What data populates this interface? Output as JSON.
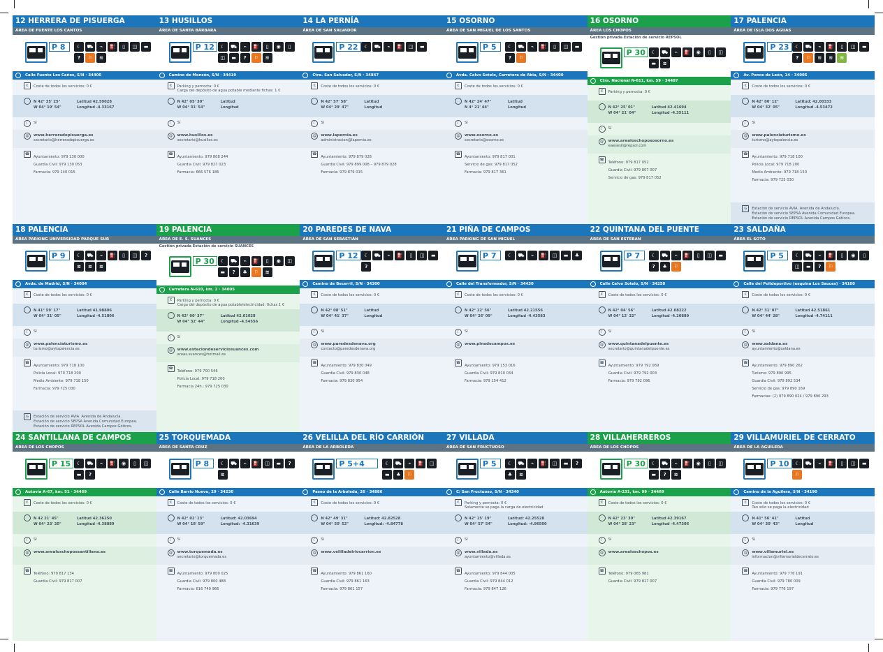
{
  "cards": [
    {
      "title": "12 HERRERA DE PISUERGA",
      "area": "ÁREA DE FUENTE LOS CANTOS",
      "note": "",
      "p": "P   8",
      "svc": [
        "☾",
        "⛟",
        "⌁",
        "⛽",
        "▯",
        "◫",
        "▬",
        "?",
        "⚐",
        "≋"
      ],
      "addr": "Calle Fuente Los Caños, S/N · 34400",
      "cost": [
        "Coste de todos los servicios: 0 €"
      ],
      "n": "N 42° 35' 25\"",
      "w": "W 04° 19' 54\"",
      "lat": "Latitud 42.59028",
      "lon": "Longitud -4.33167",
      "open": "Sí",
      "web": "www.herreradepisuerga.es",
      "mail": "secretario@herreradepisuerga.es",
      "tel": [
        "Ayuntamiento: 979 130 000",
        "Guardia Civil: 979 130 053",
        "Farmacia: 979 140 015"
      ],
      "glp": []
    },
    {
      "title": "13 HUSILLOS",
      "area": "ÁREA DE SANTA BÁRBARA",
      "note": "",
      "p": "P 12",
      "svc": [
        "☾",
        "⛟",
        "⌁",
        "⛽",
        "▯",
        "◉",
        "▯",
        "◫",
        "▬",
        "?",
        "⚐",
        "≋"
      ],
      "addr": "Camino de Monzón, S/N · 34419",
      "cost": [
        "Parking y pernocta: 0 €",
        "Carga del depósito de agua potable mediante fichas: 1 €"
      ],
      "n": "N 42° 05' 30\"",
      "w": "W 04° 31' 54\"",
      "lat": "Latitud",
      "lon": "Longitud",
      "open": "Sí",
      "web": "www.husillos.es",
      "mail": "secretario@husillos.es",
      "tel": [
        "Ayuntamiento: 979 808 244",
        "Guardia Civil: 979 827 023",
        "Farmacia: 666 576 186"
      ],
      "glp": []
    },
    {
      "title": "14 LA PERNÍA",
      "area": "ÁREA DE SAN SALVADOR",
      "note": "",
      "p": "P 22",
      "svc": [
        "☾",
        "⛟",
        "⌁",
        "⛽",
        "◫",
        "▬"
      ],
      "addr": "Ctra. San Salvador, S/N · 34847",
      "cost": [
        "Coste de todos los servicios: 0 €"
      ],
      "n": "N 42° 57' 58\"",
      "w": "W 04° 29' 47\"",
      "lat": "Latitud",
      "lon": "Longitud",
      "open": "Sí",
      "web": "www.lapernia.es",
      "mail": "administracion@lapernia.es",
      "tel": [
        "Ayuntamiento: 979 879 028",
        "Guardia Civil: 979 899 008 – 979 879 028",
        "Farmacia: 979 879 015"
      ],
      "glp": []
    },
    {
      "title": "15 OSORNO",
      "area": "ÁREA DE SAN MIGUEL DE LOS SANTOS",
      "note": "",
      "p": "P   5",
      "svc": [
        "☾",
        "⛟",
        "⌁",
        "⛽",
        "▯",
        "◫",
        "▬",
        "?",
        "⚐"
      ],
      "addr": "Avda. Calvo Sotelo, Carretera de Abia, S/N · 34400",
      "cost": [
        "Coste de todos los servicios: 0 €"
      ],
      "n": "N 42° 24' 47\"",
      "w": "N 4° 21' 44\"",
      "lat": "Latitud",
      "lon": "Longitud",
      "open": "Sí",
      "web": "www.osorno.es",
      "mail": "secretario@osorno.es",
      "tel": [
        "Ayuntamiento: 979 817 001",
        "Servicio de gas: 979 817 052",
        "Farmacia: 979 817 361"
      ],
      "glp": []
    },
    {
      "title": "16 OSORNO",
      "area": "ÁREA LOS CHOPOS",
      "note": "Gestión privada Estación de servicio REPSOL",
      "p": "P 30",
      "svc": [
        "☾",
        "⛟",
        "⌁",
        "⛽",
        "◉",
        "▯",
        "◫",
        "▬",
        "≋"
      ],
      "addr": "Ctra. Nacional N-611, km. 59 · 34487",
      "cost": [
        "Parking y pernocta: 0 €"
      ],
      "n": "N 42° 25' 01\"",
      "w": "W 04° 21' 04\"",
      "lat": "Latitud 42.41694",
      "lon": "Longitud -4.35111",
      "open": "Sí",
      "web": "www.arealoschopososorno.es",
      "mail": "eaesesil@repsol.com",
      "tel": [
        "Teléfono: 979 817 052",
        "Guardia Civil: 979 807 007",
        "Servicio de gas: 979 817 052"
      ],
      "glp": []
    },
    {
      "title": "17 PALENCIA",
      "area": "ÁREA DE ISLA DOS AGUAS",
      "note": "",
      "p": "P 23",
      "svc": [
        "☾",
        "⛟",
        "⌁",
        "⛽",
        "▯",
        "◫",
        "▬",
        "?",
        "⚐",
        "≋",
        "≋",
        "≋"
      ],
      "addr": "Av. Ponce de León, 14 · 34005",
      "cost": [
        "Coste de todos los servicios: 0 €"
      ],
      "n": "N 42° 00' 12\"",
      "w": "W 04° 32' 05\"",
      "lat": "Latitud: 42.00333",
      "lon": "Longitud -4.53472",
      "open": "Sí",
      "web": "www.palenciaturismo.es",
      "mail": "turismo@aytopalencia.es",
      "tel": [
        "Ayuntamiento: 979 718 100",
        "Policía Local: 979 718 200",
        "Medio Ambiente: 979 718 150",
        "Farmacia: 979 725 030"
      ],
      "glp": [
        "Estación de servicio AVIA. Avenida de Andalucía.",
        "Estación de servicio SEPSA Avenida Comunidad Europea.",
        "Estación de servicio REPSOL Avenida Campos Góticos."
      ]
    },
    {
      "title": "18 PALENCIA",
      "area": "ÁREA PARKING UNIVERSIDAD PARQUE SUR",
      "note": "",
      "p": "P   9",
      "svc": [
        "☾",
        "⛟",
        "⌁",
        "⛽",
        "▯",
        "◫",
        "?",
        "≋",
        "≋",
        "≋"
      ],
      "addr": "Avda. de Madrid, S/N · 34004",
      "cost": [
        "Coste de todos los servicios: 0 €"
      ],
      "n": "N 41° 59' 17\"",
      "w": "W 04° 31' 05\"",
      "lat": "Latitud 41.98806",
      "lon": "Longitud -4.51806",
      "open": "Sí",
      "web": "www.palenciaturismo.es",
      "mail": "turismo@aytopalencia.es",
      "tel": [
        "Ayuntamiento: 979 718 100",
        "Policía Local: 979 718 200",
        "Medio Ambiente: 979 718 150",
        "Farmacia: 979 725 030"
      ],
      "glp": [
        "Estación de servicio AVIA. Avenida de Andalucía.",
        "Estación de servicio SEPSA Avenida Comunidad Europea.",
        "Estación de servicio REPSOL Avenida Campos Góticos."
      ]
    },
    {
      "title": "19 PALENCIA",
      "area": "ÁREA DE E. S. SUANCES",
      "note": "Gestión privada Estación de servicio SUANCES",
      "p": "P 30",
      "svc": [
        "☾",
        "⛟",
        "⌁",
        "⛽",
        "▯",
        "◉",
        "◫",
        "▬",
        "?",
        "♣",
        "⚐",
        "≋"
      ],
      "addr": "Carretera N-610, km. 2 · 34005",
      "cost": [
        "Parking y pernocta: 0 €",
        "Carga del depósito de agua potable/electricidad: fichas 1 €"
      ],
      "n": "N 42° 00' 37\"",
      "w": "W 04° 32' 44\"",
      "lat": "Latitud 42.01028",
      "lon": "Longitud -4.54556",
      "open": "Sí",
      "web": "www.estaciondeserviciosuances.com",
      "mail": "areas.suances@hotmail.es",
      "tel": [
        "Teléfono: 979 700 546",
        "Policía Local: 979 718 200",
        "Farmacia 24h.: 979 725 030"
      ],
      "glp": []
    },
    {
      "title": "20 PAREDES DE NAVA",
      "area": "ÁREA DE SAN SEBASTIÁN",
      "note": "",
      "p": "P 12",
      "svc": [
        "☾",
        "⛟",
        "⌁",
        "⛽",
        "▯",
        "◫",
        "▬",
        "?"
      ],
      "addr": "Camino de Becerril, S/N · 34300",
      "cost": [
        "Coste de todos los servicios: 0 €"
      ],
      "n": "N 42° 08' 51\"",
      "w": "W 04° 41' 37\"",
      "lat": "Latitud",
      "lon": "Longitud",
      "open": "Sí",
      "web": "www.paredesdenava.org",
      "mail": "contacto@paredesdenava.org",
      "tel": [
        "Ayuntamiento: 979 830 049",
        "Guardia Civil: 979 830 048",
        "Farmacia: 979 830 954"
      ],
      "glp": []
    },
    {
      "title": "21 PIÑA DE CAMPOS",
      "area": "ÁREA PARKING DE SAN MIGUEL",
      "note": "",
      "p": "P   7",
      "svc": [
        "☾",
        "⛟",
        "⌁",
        "⛽",
        "◫",
        "▬",
        "♣"
      ],
      "addr": "Calle del Transformador, S/N · 34430",
      "cost": [
        "Coste de todos los servicios: 0 €"
      ],
      "n": "N 42° 12' 56\"",
      "w": "W 04° 26' 09\"",
      "lat": "Latitud 42.21556",
      "lon": "Longitud -4.43583",
      "open": "Sí",
      "web": "www.pinadecampos.es",
      "mail": "",
      "tel": [
        "Ayuntamiento: 979 153 016",
        "Guardia Civil: 979 810 034",
        "Farmacia: 979 154 412"
      ],
      "glp": []
    },
    {
      "title": "22 QUINTANA DEL PUENTE",
      "area": "ÁREA DE SAN ESTEBAN",
      "note": "",
      "p": "P   7",
      "svc": [
        "☾",
        "⛟",
        "⌁",
        "⛽",
        "▯",
        "◫",
        "▬",
        "?",
        "♣",
        "⚐"
      ],
      "addr": "Calle Calvo Sotelo, S/N · 34250",
      "cost": [
        "Coste de todos los servicios: 0 €"
      ],
      "n": "N 42° 04' 56\"",
      "w": "W 04° 12' 32\"",
      "lat": "Latitud 42.08222",
      "lon": "Longitud -4.20889",
      "open": "Sí",
      "web": "www.quintanadelpuente.es",
      "mail": "secretario@quintanadelpuente.es",
      "tel": [
        "Ayuntamiento: 979 792 069",
        "Guardia Civil: 979 792 003",
        "Farmacia: 979 792 096"
      ],
      "glp": []
    },
    {
      "title": "23 SALDAÑA",
      "area": "ÁREA EL SOTO",
      "note": "",
      "p": "P   5",
      "svc": [
        "☾",
        "⛟",
        "⌁",
        "⛽",
        "▯",
        "◉",
        "▯",
        "◫",
        "▬",
        "?",
        "⚐"
      ],
      "addr": "Calle del Polideportivo (esquina Los Sauces) · 34100",
      "cost": [
        "Coste de todos los servicios: 0 €"
      ],
      "n": "N 42° 31' 07\"",
      "w": "W 04° 44' 28\"",
      "lat": "Latitud 42.51861",
      "lon": "Longitud -4.74111",
      "open": "Sí",
      "web": "www.saldana.es",
      "mail": "ayuntamiento@saldana.es",
      "tel": [
        "Ayuntamiento: 979 890 262",
        "Turismo: 979 890 995",
        "Guardia Civil: 979 892 534",
        "Servicio de gas: 979 890 169",
        "Farmacias: (2) 979 890 024 / 979 890 293"
      ],
      "glp": []
    },
    {
      "title": "24 SANTILLANA DE CAMPOS",
      "area": "ÁREA DE LOS CHOPOS",
      "note": "",
      "p": "P 15",
      "svc": [
        "☾",
        "⛟",
        "⌁",
        "⛽",
        "◉",
        "▯",
        "◫",
        "▬",
        "?"
      ],
      "addr": "Autovía A-67, km. 51 · 34469",
      "cost": [
        "Coste de todos los servicios: 0 €"
      ],
      "n": "N 42 21' 45\"",
      "w": "W 04° 23' 20\"",
      "lat": "Latitud 42.36250",
      "lon": "Longitud -4.38889",
      "open": "Sí",
      "web": "www.arealoschopossantillana.es",
      "mail": "",
      "tel": [
        "Teléfono: 979 817 134",
        "Guardia Civil: 979 817 007"
      ],
      "glp": []
    },
    {
      "title": "25 TORQUEMADA",
      "area": "ÁREA DE SANTA CRUZ",
      "note": "",
      "p": "P   8",
      "svc": [
        "☾",
        "⛟",
        "⌁",
        "⛽",
        "◫",
        "▬",
        "?",
        "≋"
      ],
      "addr": "Calle Barrio Nuevo, 29 · 34230",
      "cost": [
        "Coste de todos los servicios: 0 €"
      ],
      "n": "N 42° 02' 13\"",
      "w": "W 04° 18' 59\"",
      "lat": "Latitud: 42.03694",
      "lon": "Longitud: -4.31639",
      "open": "Sí",
      "web": "www.torquemada.es",
      "mail": "secretario@torquemada.es",
      "tel": [
        "Ayuntamiento: 979 800 025",
        "Guardia Civil: 979 800 488",
        "Farmacia: 616 749 966"
      ],
      "glp": []
    },
    {
      "title": "26 VELILLA DEL RÍO CARRIÓN",
      "area": "ÁREA DE LA ARBOLEDA",
      "note": "",
      "p": "P     5+4",
      "svc": [
        "☾",
        "⛟",
        "⌁",
        "⛽",
        "◫",
        "▬",
        "♣",
        "⚐"
      ],
      "addr": "Paseo de la Arboleda, 26 · 34886",
      "cost": [
        "Coste de todos los servicios: 0 €"
      ],
      "n": "N 42° 49' 31\"",
      "w": "W 04° 50' 52\"",
      "lat": "Latitud: 42.82528",
      "lon": "Longitud: -4.84778",
      "open": "Sí",
      "web": "www.velilladelriocarrion.es",
      "mail": "",
      "tel": [
        "Ayuntamiento: 979 861 160",
        "Guardia Civil: 979 861 163",
        "Farmacia: 979 861 157"
      ],
      "glp": []
    },
    {
      "title": "27 VILLADA",
      "area": "ÁREA DE SAN FRUCTUOSO",
      "note": "",
      "p": "P   5",
      "svc": [
        "☾",
        "⛟",
        "⌁",
        "⛽",
        "◫",
        "▬",
        "?",
        "♣",
        "≋"
      ],
      "addr": "C/ San Fructuoso, S/N · 34340",
      "cost": [
        "Parking y pernocta: 0 €",
        "Solamente se paga la carga de electricidad"
      ],
      "n": "N 42° 15' 19\"",
      "w": "W 04° 57' 54\"",
      "lat": "Latitud: 42.25528",
      "lon": "Longitud: -4.96500",
      "open": "Sí",
      "web": "www.villada.es",
      "mail": "ayuntamiento@villada.es",
      "tel": [
        "Ayuntamiento: 979 844 005",
        "Guardia Civil: 979 844 012",
        "Farmacia: 979 847 126"
      ],
      "glp": []
    },
    {
      "title": "28 VILLAHERREROS",
      "area": "ÁREA DE LOS CHOPOS",
      "note": "",
      "p": "P 30",
      "svc": [
        "☾",
        "⛟",
        "⌁",
        "⛽",
        "◉",
        "▯",
        "◫",
        "▬",
        "?",
        "≋"
      ],
      "addr": "Autovía A-231, km. 99 · 34469",
      "cost": [
        "Coste de todos los servicios: 0 €"
      ],
      "n": "N 42° 23' 30\"",
      "w": "W 04° 28' 23\"",
      "lat": "Latitud 42.39167",
      "lon": "Longitud -4.47306",
      "open": "Sí",
      "web": "www.arealoschopos.es",
      "mail": "",
      "tel": [
        "Teléfono: 979 065 981",
        "Guardia Civil: 979 817 007"
      ],
      "glp": []
    },
    {
      "title": "29 VILLAMURIEL DE CERRATO",
      "area": "ÁREA DE LA AGUILERA",
      "note": "",
      "p": "P 10",
      "svc": [
        "☾",
        "⛟",
        "⌁",
        "⛽",
        "▯",
        "◫",
        "▬",
        "⚐"
      ],
      "addr": "Camino de la Aguilera, S/N · 34190",
      "cost": [
        "Coste de todos los servicios: 0 €",
        "Tan sólo se paga la electricidad"
      ],
      "n": "N 41° 56' 41\"",
      "w": "W 04° 30' 43\"",
      "lat": "Latitud",
      "lon": "Longitud",
      "open": "Sí",
      "web": "www.villamuriel.es",
      "mail": "informacion@villamurieldecerrato.es",
      "tel": [
        "Ayuntamiento: 979 776 191",
        "Guardia Civil: 979 780 009",
        "Farmacia: 979 776 197"
      ],
      "glp": []
    }
  ],
  "private_flags": [
    false,
    false,
    false,
    false,
    true,
    false,
    false,
    true,
    false,
    false,
    false,
    false,
    true,
    false,
    false,
    false,
    true,
    false
  ],
  "icons": {
    "pin": "location-pin-icon",
    "euro": "euro-icon",
    "gps": "compass-icon",
    "open": "calendar-moon-icon",
    "web": "at-sign-icon",
    "tel": "telephone-icon",
    "glp": "glp-gas-icon",
    "van": "camper-van-icon"
  },
  "colors": {
    "public": "#1b76bc",
    "private": "#1aa14a",
    "subbar": "#5b7383",
    "orange": "#e87722",
    "green": "#82b541"
  }
}
